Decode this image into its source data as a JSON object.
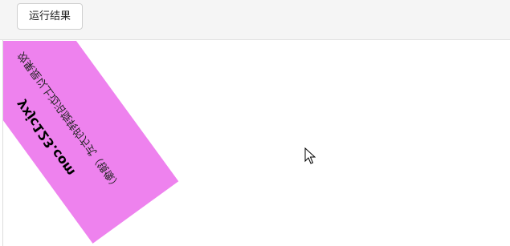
{
  "toolbar": {
    "run_label": "运行结果"
  },
  "card": {
    "title": "yxjc123.com",
    "subtitle": "效果是以上边沿旋转的方式（镜像）",
    "color": "#ee82ee"
  },
  "cursor": {
    "icon": "arrow-pointer-icon"
  }
}
